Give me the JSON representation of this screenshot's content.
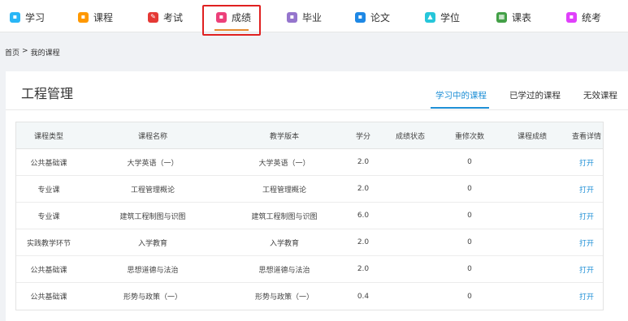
{
  "nav": {
    "items": [
      {
        "label": "学习",
        "icon": "learning-icon",
        "color": "#29b6f6"
      },
      {
        "label": "课程",
        "icon": "course-icon",
        "color": "#ff9800"
      },
      {
        "label": "考试",
        "icon": "exam-icon",
        "color": "#e53935"
      },
      {
        "label": "成绩",
        "icon": "grades-icon",
        "color": "#ec407a"
      },
      {
        "label": "毕业",
        "icon": "graduation-icon",
        "color": "#9575cd"
      },
      {
        "label": "论文",
        "icon": "thesis-icon",
        "color": "#1e88e5"
      },
      {
        "label": "学位",
        "icon": "degree-icon",
        "color": "#26c6da"
      },
      {
        "label": "课表",
        "icon": "timetable-icon",
        "color": "#43a047"
      },
      {
        "label": "统考",
        "icon": "unified-exam-icon",
        "color": "#e040fb"
      }
    ],
    "active": "成绩"
  },
  "breadcrumb": {
    "home": "首页",
    "separator": ">",
    "current": "我的课程"
  },
  "main": {
    "title": "工程管理",
    "tabs": [
      {
        "label": "学习中的课程",
        "active": true
      },
      {
        "label": "已学过的课程",
        "active": false
      },
      {
        "label": "无效课程",
        "active": false
      }
    ]
  },
  "table": {
    "headers": [
      "课程类型",
      "课程名称",
      "教学版本",
      "学分",
      "成绩状态",
      "重修次数",
      "课程成绩",
      "查看详情"
    ],
    "rows": [
      [
        "公共基础课",
        "大学英语（一）",
        "大学英语（一）",
        "2.0",
        "",
        "0",
        "",
        "打开"
      ],
      [
        "专业课",
        "工程管理概论",
        "工程管理概论",
        "2.0",
        "",
        "0",
        "",
        "打开"
      ],
      [
        "专业课",
        "建筑工程制图与识图",
        "建筑工程制图与识图",
        "6.0",
        "",
        "0",
        "",
        "打开"
      ],
      [
        "实践教学环节",
        "入学教育",
        "入学教育",
        "2.0",
        "",
        "0",
        "",
        "打开"
      ],
      [
        "公共基础课",
        "思想道德与法治",
        "思想道德与法治",
        "2.0",
        "",
        "0",
        "",
        "打开"
      ],
      [
        "公共基础课",
        "形势与政策（一）",
        "形势与政策（一）",
        "0.4",
        "",
        "0",
        "",
        "打开"
      ]
    ]
  }
}
